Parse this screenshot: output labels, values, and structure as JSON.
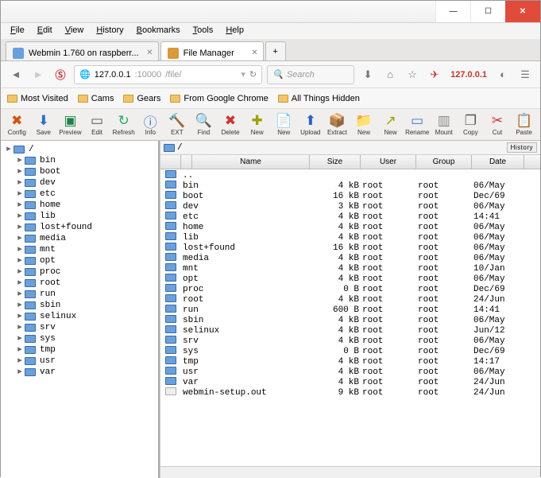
{
  "menu": [
    "File",
    "Edit",
    "View",
    "History",
    "Bookmarks",
    "Tools",
    "Help"
  ],
  "tabs": [
    {
      "label": "Webmin 1.760 on raspberr...",
      "active": false,
      "icon": "fv-webmin"
    },
    {
      "label": "File Manager",
      "active": true,
      "icon": "fv-fm"
    }
  ],
  "url": {
    "host": "127.0.0.1",
    "port": ":10000",
    "path": "/file/"
  },
  "search_placeholder": "Search",
  "ip_badge": "127.0.0.1",
  "bookmarks": [
    "Most Visited",
    "Cams",
    "Gears",
    "From Google Chrome",
    "All Things Hidden"
  ],
  "toolbar": [
    {
      "l": "Config",
      "i": "✖",
      "c": "#d35400"
    },
    {
      "l": "Save",
      "i": "⬇",
      "c": "#2d72c8"
    },
    {
      "l": "Preview",
      "i": "▣",
      "c": "#1e8244"
    },
    {
      "l": "Edit",
      "i": "▭",
      "c": "#555"
    },
    {
      "l": "Refresh",
      "i": "↻",
      "c": "#27ae60"
    },
    {
      "l": "Info",
      "i": "ⓘ",
      "c": "#2d72c8"
    },
    {
      "l": "EXT",
      "i": "🔨",
      "c": "#a0622d"
    },
    {
      "l": "Find",
      "i": "🔍",
      "c": "#555"
    },
    {
      "l": "Delete",
      "i": "✖",
      "c": "#cc3333"
    },
    {
      "l": "New",
      "i": "✚",
      "c": "#a0a000"
    },
    {
      "l": "New",
      "i": "📄",
      "c": "#3a7abd"
    },
    {
      "l": "Upload",
      "i": "⬆",
      "c": "#2962c4"
    },
    {
      "l": "Extract",
      "i": "📦",
      "c": "#a0622d"
    },
    {
      "l": "New",
      "i": "📁",
      "c": "#3a7abd"
    },
    {
      "l": "New",
      "i": "↗",
      "c": "#a0a000"
    },
    {
      "l": "Rename",
      "i": "▭",
      "c": "#3a7abd"
    },
    {
      "l": "Mount",
      "i": "▥",
      "c": "#888"
    },
    {
      "l": "Copy",
      "i": "❐",
      "c": "#555"
    },
    {
      "l": "Cut",
      "i": "✂",
      "c": "#cc3333"
    },
    {
      "l": "Paste",
      "i": "📋",
      "c": "#a0622d"
    }
  ],
  "tree_root": "/",
  "tree": [
    "bin",
    "boot",
    "dev",
    "etc",
    "home",
    "lib",
    "lost+found",
    "media",
    "mnt",
    "opt",
    "proc",
    "root",
    "run",
    "sbin",
    "selinux",
    "srv",
    "sys",
    "tmp",
    "usr",
    "var"
  ],
  "path": "/",
  "history_label": "History",
  "columns": [
    "",
    "",
    "Name",
    "Size",
    "User",
    "Group",
    "Date"
  ],
  "parent_dir": "..",
  "files": [
    {
      "n": "bin",
      "s": "4 kB",
      "u": "root",
      "g": "root",
      "d": "06/May",
      "t": "d"
    },
    {
      "n": "boot",
      "s": "16 kB",
      "u": "root",
      "g": "root",
      "d": "Dec/69",
      "t": "d"
    },
    {
      "n": "dev",
      "s": "3 kB",
      "u": "root",
      "g": "root",
      "d": "06/May",
      "t": "d"
    },
    {
      "n": "etc",
      "s": "4 kB",
      "u": "root",
      "g": "root",
      "d": "14:41",
      "t": "d"
    },
    {
      "n": "home",
      "s": "4 kB",
      "u": "root",
      "g": "root",
      "d": "06/May",
      "t": "d"
    },
    {
      "n": "lib",
      "s": "4 kB",
      "u": "root",
      "g": "root",
      "d": "06/May",
      "t": "d"
    },
    {
      "n": "lost+found",
      "s": "16 kB",
      "u": "root",
      "g": "root",
      "d": "06/May",
      "t": "d"
    },
    {
      "n": "media",
      "s": "4 kB",
      "u": "root",
      "g": "root",
      "d": "06/May",
      "t": "d"
    },
    {
      "n": "mnt",
      "s": "4 kB",
      "u": "root",
      "g": "root",
      "d": "10/Jan",
      "t": "d"
    },
    {
      "n": "opt",
      "s": "4 kB",
      "u": "root",
      "g": "root",
      "d": "06/May",
      "t": "d"
    },
    {
      "n": "proc",
      "s": "0 B",
      "u": "root",
      "g": "root",
      "d": "Dec/69",
      "t": "d"
    },
    {
      "n": "root",
      "s": "4 kB",
      "u": "root",
      "g": "root",
      "d": "24/Jun",
      "t": "d"
    },
    {
      "n": "run",
      "s": "600 B",
      "u": "root",
      "g": "root",
      "d": "14:41",
      "t": "d"
    },
    {
      "n": "sbin",
      "s": "4 kB",
      "u": "root",
      "g": "root",
      "d": "06/May",
      "t": "d"
    },
    {
      "n": "selinux",
      "s": "4 kB",
      "u": "root",
      "g": "root",
      "d": "Jun/12",
      "t": "d"
    },
    {
      "n": "srv",
      "s": "4 kB",
      "u": "root",
      "g": "root",
      "d": "06/May",
      "t": "d"
    },
    {
      "n": "sys",
      "s": "0 B",
      "u": "root",
      "g": "root",
      "d": "Dec/69",
      "t": "d"
    },
    {
      "n": "tmp",
      "s": "4 kB",
      "u": "root",
      "g": "root",
      "d": "14:17",
      "t": "d"
    },
    {
      "n": "usr",
      "s": "4 kB",
      "u": "root",
      "g": "root",
      "d": "06/May",
      "t": "d"
    },
    {
      "n": "var",
      "s": "4 kB",
      "u": "root",
      "g": "root",
      "d": "24/Jun",
      "t": "d"
    },
    {
      "n": "webmin-setup.out",
      "s": "9 kB",
      "u": "root",
      "g": "root",
      "d": "24/Jun",
      "t": "f"
    }
  ]
}
